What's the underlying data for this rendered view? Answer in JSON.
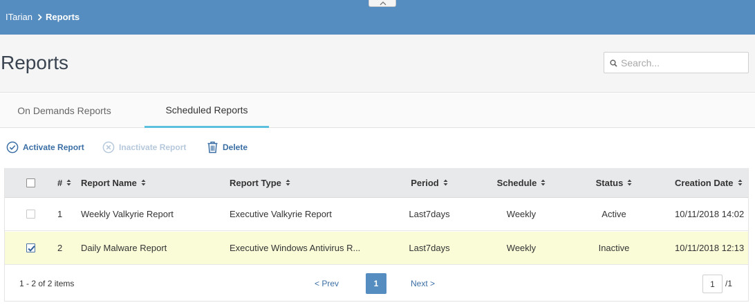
{
  "breadcrumb": {
    "root": "ITarian",
    "current": "Reports"
  },
  "page": {
    "title": "Reports"
  },
  "search": {
    "placeholder": "Search..."
  },
  "tabs": [
    {
      "label": "On Demands Reports",
      "active": false
    },
    {
      "label": "Scheduled Reports",
      "active": true
    }
  ],
  "toolbar": {
    "activate_label": "Activate Report",
    "inactivate_label": "Inactivate Report",
    "delete_label": "Delete"
  },
  "table": {
    "columns": [
      "#",
      "Report Name",
      "Report Type",
      "Period",
      "Schedule",
      "Status",
      "Creation Date"
    ],
    "rows": [
      {
        "num": "1",
        "name": "Weekly Valkyrie Report",
        "type": "Executive Valkyrie Report",
        "period": "Last7days",
        "schedule": "Weekly",
        "status": "Active",
        "date": "10/11/2018 14:02",
        "checked": false
      },
      {
        "num": "2",
        "name": "Daily Malware Report",
        "type": "Executive Windows Antivirus R...",
        "period": "Last7days",
        "schedule": "Weekly",
        "status": "Inactive",
        "date": "10/11/2018 12:13",
        "checked": true
      }
    ]
  },
  "pager": {
    "info": "1 - 2 of 2 items",
    "prev": "< Prev",
    "next": "Next >",
    "current_page": "1",
    "page_input": "1",
    "total_pages": "/1"
  },
  "colors": {
    "topbar": "#568dc0",
    "link": "#3a6ea5",
    "tab_accent": "#5bc0de",
    "selected_row": "#fafcd8",
    "disabled": "#b6c8dc"
  },
  "icons": {
    "breadcrumb_sep": "chevron-right-icon",
    "collapse": "chevron-up-icon",
    "search": "search-icon",
    "activate": "check-circle-icon",
    "inactivate": "x-circle-icon",
    "delete": "trash-icon",
    "sort": "sort-icon"
  }
}
